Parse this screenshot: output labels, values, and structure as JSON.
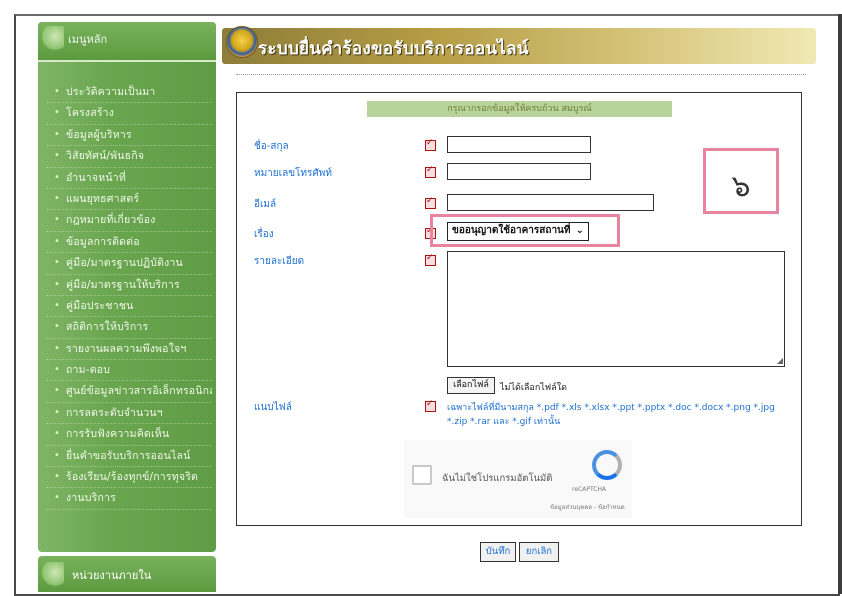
{
  "sidebar": {
    "header": "เมนูหลัก",
    "items": [
      {
        "label": "ประวัติความเป็นมา"
      },
      {
        "label": "โครงสร้าง"
      },
      {
        "label": "ข้อมูลผู้บริหาร"
      },
      {
        "label": "วิสัยทัศน์/พันธกิจ"
      },
      {
        "label": "อำนาจหน้าที่"
      },
      {
        "label": "แผนยุทธศาสตร์"
      },
      {
        "label": "กฎหมายที่เกี่ยวข้อง"
      },
      {
        "label": "ข้อมูลการติดต่อ"
      },
      {
        "label": "คู่มือ/มาตรฐานปฏิบัติงาน"
      },
      {
        "label": "คู่มือ/มาตรฐานให้บริการ"
      },
      {
        "label": "คู่มือประชาชน"
      },
      {
        "label": "สถิติการให้บริการ"
      },
      {
        "label": "รายงานผลความพึงพอใจฯ"
      },
      {
        "label": "ถาม-ตอบ"
      },
      {
        "label": "ศูนย์ข้อมูลข่าวสารอิเล็กทรอนิกส์"
      },
      {
        "label": "การลดระดับจำนวนฯ"
      },
      {
        "label": "การรับฟังความคิดเห็น"
      },
      {
        "label": "ยื่นคำขอรับบริการออนไลน์"
      },
      {
        "label": "ร้องเรียน/ร้องทุกข์/การทุจริต"
      },
      {
        "label": "งานบริการ"
      }
    ],
    "footer": "หน่วยงานภายใน"
  },
  "header": {
    "title": "ระบบยื่นคำร้องขอรับบริการออนไลน์"
  },
  "form": {
    "caption": "กรุณากรอกข้อมูลให้ครบถ้วน สมบูรณ์",
    "fields": {
      "name_label": "ชื่อ-สกุล",
      "phone_label": "หมายเลขโทรศัพท์",
      "email_label": "อีเมล์",
      "subject_label": "เรื่อง",
      "subject_value": "ขออนุญาตใช้อาคารสถานที่",
      "detail_label": "รายละเอียด",
      "attach_label": "แนบไฟล์",
      "file_button": "เลือกไฟล์",
      "file_status": "ไม่ได้เลือกไฟล์ใด",
      "file_note": "เฉพาะไฟล์ที่มีนามสกุล *.pdf *.xls *.xlsx *.ppt *.pptx *.doc *.docx *.png *.jpg *.zip *.rar และ *.gif เท่านั้น"
    },
    "captcha": {
      "text": "ฉันไม่ใช่โปรแกรมอัตโนมัติ",
      "brand": "reCAPTCHA",
      "links": "ข้อมูลส่วนบุคคล - ข้อกำหนด"
    },
    "buttons": {
      "save": "บันทึก",
      "cancel": "ยกเลิก"
    }
  },
  "annotation": {
    "number": "๖"
  },
  "colors": {
    "sidebar": "#6aa64f",
    "banner": "#b59c44",
    "highlight": "#e884a0",
    "label": "#1e6fd0"
  }
}
